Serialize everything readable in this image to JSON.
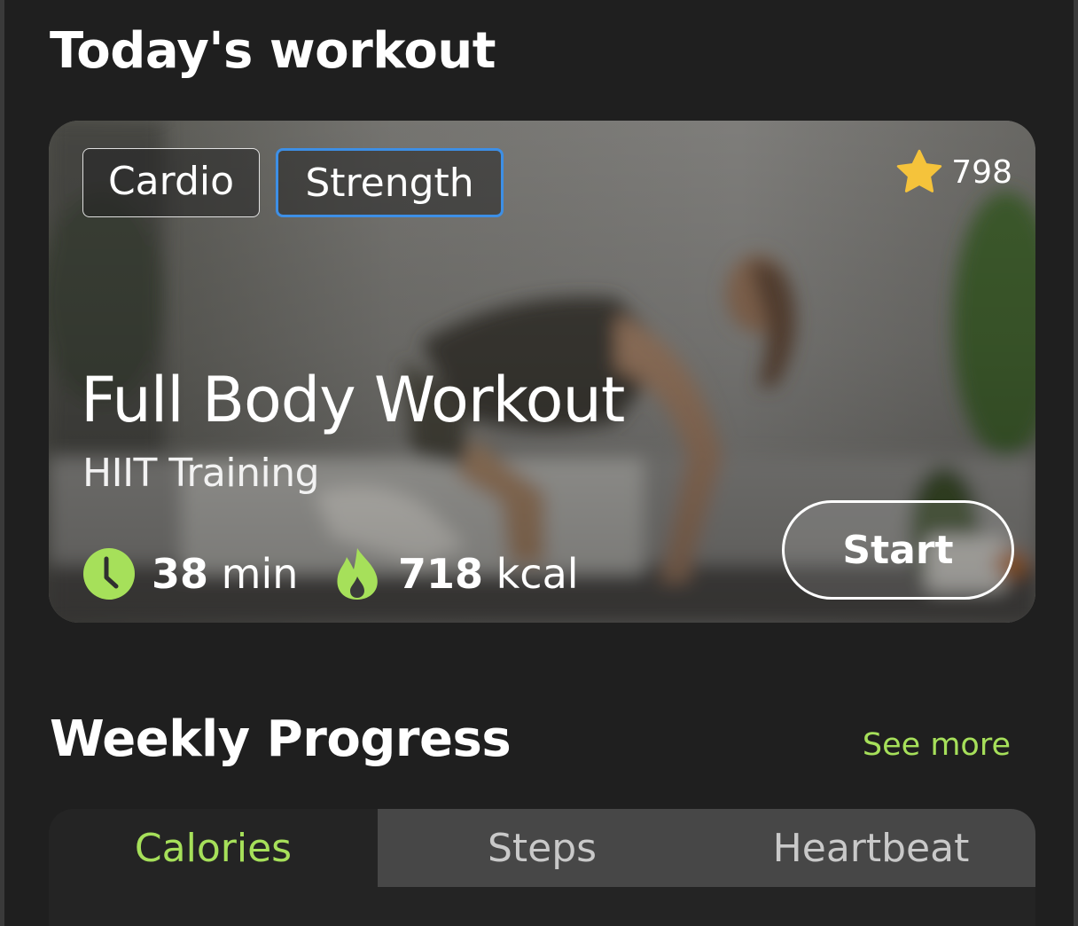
{
  "todays_workout": {
    "heading": "Today's workout",
    "tags": [
      {
        "label": "Cardio",
        "selected": false
      },
      {
        "label": "Strength",
        "selected": true
      }
    ],
    "rating": {
      "icon": "star-icon",
      "value": "798",
      "color": "#f5c33b"
    },
    "title": "Full Body Workout",
    "subtitle": "HIIT Training",
    "duration": {
      "icon": "clock-icon",
      "value": "38",
      "unit": "min"
    },
    "calories": {
      "icon": "flame-icon",
      "value": "718",
      "unit": "kcal"
    },
    "start_label": "Start",
    "selected_tag_border_color": "#3d8fe6"
  },
  "weekly_progress": {
    "heading": "Weekly Progress",
    "see_more_label": "See more",
    "tabs": [
      {
        "label": "Calories",
        "active": true
      },
      {
        "label": "Steps",
        "active": false
      },
      {
        "label": "Heartbeat",
        "active": false
      }
    ]
  },
  "colors": {
    "accent": "#a6e05a",
    "background": "#1f1f1f",
    "inactive_tab": "#474747"
  }
}
